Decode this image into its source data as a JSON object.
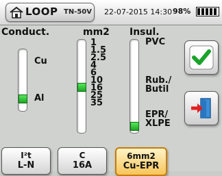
{
  "header": {
    "title": "LOOP",
    "system": "TN-50V",
    "datetime": "22-07-2015 14:30",
    "battery": "98%",
    "home_icon": "home-icon",
    "battery_icon": "battery-icon"
  },
  "columns": {
    "conductor": {
      "title": "Conduct.",
      "options": [
        "Cu",
        "Al"
      ],
      "selected": "Al"
    },
    "section": {
      "title": "mm2",
      "options": [
        "1",
        "1.5",
        "2.5",
        "4",
        "6",
        "10",
        "16",
        "25",
        "35"
      ],
      "selected": "6"
    },
    "insulation": {
      "title": "Insul.",
      "options": [
        "PVC",
        "Rub./",
        "Butil",
        "EPR/",
        "XLPE"
      ],
      "selected": "EPR/XLPE"
    }
  },
  "actions": {
    "confirm_icon": "checkmark-icon",
    "exit_icon": "exit-door-icon"
  },
  "tabs": [
    {
      "line1": "I²t",
      "line2": "L-N"
    },
    {
      "line1": "C",
      "line2": "16A"
    },
    {
      "line1": "6mm2",
      "line2": "Cu-EPR",
      "active": true
    }
  ],
  "colors": {
    "selected_indicator": "#2ecb36",
    "active_tab": "#f6c45a"
  }
}
